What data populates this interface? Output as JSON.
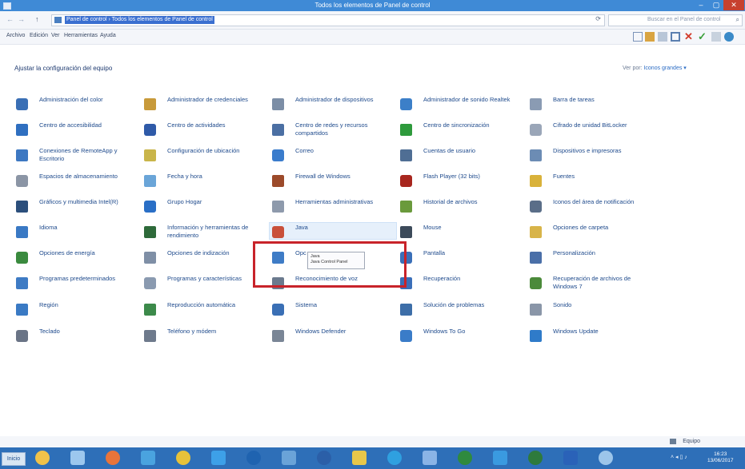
{
  "window": {
    "title": "Todos los elementos de Panel de control",
    "minimize": "–",
    "maximize": "▢",
    "close": "✕"
  },
  "address": {
    "back": "←",
    "forward": "→",
    "up": "↑",
    "path": "Panel de control › Todos los elementos de Panel de control",
    "refresh": "⟳",
    "search_placeholder": "Buscar en el Panel de control"
  },
  "menu": [
    "Archivo",
    "Edición",
    "Ver",
    "Herramientas",
    "Ayuda"
  ],
  "header": {
    "title": "Ajustar la configuración del equipo",
    "view_by_label": "Ver por:",
    "view_by_value": "Iconos grandes ▾"
  },
  "items": [
    {
      "label": "Administración del color",
      "icon": "color-management-icon",
      "color": "#3a6fb5"
    },
    {
      "label": "Administrador de credenciales",
      "icon": "credential-manager-icon",
      "color": "#c89a3a"
    },
    {
      "label": "Administrador de dispositivos",
      "icon": "device-manager-icon",
      "color": "#7c8ea6"
    },
    {
      "label": "Administrador de sonido Realtek",
      "icon": "realtek-audio-icon",
      "color": "#3c7fc8"
    },
    {
      "label": "Barra de tareas",
      "icon": "taskbar-icon",
      "color": "#8a9bb3"
    },
    {
      "label": "Centro de accesibilidad",
      "icon": "accessibility-icon",
      "color": "#2f6fc0"
    },
    {
      "label": "Centro de actividades",
      "icon": "action-center-icon",
      "color": "#2f5aa8"
    },
    {
      "label": "Centro de redes y recursos compartidos",
      "icon": "network-center-icon",
      "color": "#4b6fa3"
    },
    {
      "label": "Centro de sincronización",
      "icon": "sync-center-icon",
      "color": "#2e9a3c"
    },
    {
      "label": "Cifrado de unidad BitLocker",
      "icon": "bitlocker-icon",
      "color": "#9aa6b8"
    },
    {
      "label": "Conexiones de RemoteApp y Escritorio",
      "icon": "remoteapp-icon",
      "color": "#3d78c2"
    },
    {
      "label": "Configuración de ubicación",
      "icon": "location-settings-icon",
      "color": "#c9b54a"
    },
    {
      "label": "Correo",
      "icon": "mail-icon",
      "color": "#3a7ccc"
    },
    {
      "label": "Cuentas de usuario",
      "icon": "user-accounts-icon",
      "color": "#4f6e94"
    },
    {
      "label": "Dispositivos e impresoras",
      "icon": "printers-icon",
      "color": "#6c8cb4"
    },
    {
      "label": "Espacios de almacenamiento",
      "icon": "storage-spaces-icon",
      "color": "#8b95a5"
    },
    {
      "label": "Fecha y hora",
      "icon": "clock-icon",
      "color": "#6aa5d8"
    },
    {
      "label": "Firewall de Windows",
      "icon": "firewall-icon",
      "color": "#9c4a2a"
    },
    {
      "label": "Flash Player (32 bits)",
      "icon": "flash-icon",
      "color": "#a8261e"
    },
    {
      "label": "Fuentes",
      "icon": "fonts-icon",
      "color": "#d9b23a"
    },
    {
      "label": "Gráficos y multimedia Intel(R)",
      "icon": "intel-graphics-icon",
      "color": "#2c4f7c"
    },
    {
      "label": "Grupo Hogar",
      "icon": "homegroup-icon",
      "color": "#2a6fc6"
    },
    {
      "label": "Herramientas administrativas",
      "icon": "admin-tools-icon",
      "color": "#8e9aac"
    },
    {
      "label": "Historial de archivos",
      "icon": "file-history-icon",
      "color": "#6a9a3c"
    },
    {
      "label": "Iconos del área de notificación",
      "icon": "notification-icons-icon",
      "color": "#5a6e88"
    },
    {
      "label": "Idioma",
      "icon": "language-icon",
      "color": "#3a79c4"
    },
    {
      "label": "Información y herramientas de rendimiento",
      "icon": "performance-icon",
      "color": "#2e6a3a"
    },
    {
      "label": "Java",
      "icon": "java-icon",
      "color": "#c9503a"
    },
    {
      "label": "Mouse",
      "icon": "mouse-icon",
      "color": "#3c4a5a"
    },
    {
      "label": "Opciones de carpeta",
      "icon": "folder-options-icon",
      "color": "#d8b449"
    },
    {
      "label": "Opciones de energía",
      "icon": "power-options-icon",
      "color": "#3a8a3e"
    },
    {
      "label": "Opciones de indización",
      "icon": "indexing-icon",
      "color": "#7f8fa6"
    },
    {
      "label": "Opc",
      "icon": "internet-options-icon",
      "color": "#3e7cc6"
    },
    {
      "label": "Pantalla",
      "icon": "display-icon",
      "color": "#3a6fb8"
    },
    {
      "label": "Personalización",
      "icon": "personalization-icon",
      "color": "#4a6fa8"
    },
    {
      "label": "Programas predeterminados",
      "icon": "default-programs-icon",
      "color": "#3e7bc4"
    },
    {
      "label": "Programas y características",
      "icon": "programs-features-icon",
      "color": "#8a9ab0"
    },
    {
      "label": "Reconocimiento de voz",
      "icon": "speech-recognition-icon",
      "color": "#6b7a8e"
    },
    {
      "label": "Recuperación",
      "icon": "recovery-icon",
      "color": "#3b6fb9"
    },
    {
      "label": "Recuperación de archivos de Windows 7",
      "icon": "windows7-recovery-icon",
      "color": "#4b8a3a"
    },
    {
      "label": "Región",
      "icon": "region-icon",
      "color": "#3a7ac4"
    },
    {
      "label": "Reproducción automática",
      "icon": "autoplay-icon",
      "color": "#3c8a4a"
    },
    {
      "label": "Sistema",
      "icon": "system-icon",
      "color": "#3a6fb5"
    },
    {
      "label": "Solución de problemas",
      "icon": "troubleshooting-icon",
      "color": "#3d6ea8"
    },
    {
      "label": "Sonido",
      "icon": "sound-icon",
      "color": "#8a96a8"
    },
    {
      "label": "Teclado",
      "icon": "keyboard-icon",
      "color": "#6a7486"
    },
    {
      "label": "Teléfono y módem",
      "icon": "phone-modem-icon",
      "color": "#6e7a8c"
    },
    {
      "label": "Windows Defender",
      "icon": "defender-icon",
      "color": "#7a8696"
    },
    {
      "label": "Windows To Go",
      "icon": "windows-to-go-icon",
      "color": "#3a7cc8"
    },
    {
      "label": "Windows Update",
      "icon": "windows-update-icon",
      "color": "#2f7bc9"
    }
  ],
  "tooltip": {
    "title": "Java",
    "body": "Java Control Panel"
  },
  "status": {
    "text": "Equipo"
  },
  "taskbar": {
    "start": "Inicio",
    "clock_time": "16:23",
    "clock_date": "13/06/2017",
    "apps": [
      {
        "icon": "file-explorer-icon",
        "color": "#f0c24a"
      },
      {
        "icon": "command-prompt-icon",
        "color": "#9cc7ee"
      },
      {
        "icon": "firefox-icon",
        "color": "#e8743a"
      },
      {
        "icon": "search-icon",
        "color": "#4aa3df"
      },
      {
        "icon": "chrome-icon",
        "color": "#e6c23a"
      },
      {
        "icon": "internet-explorer-icon",
        "color": "#3da0e8"
      },
      {
        "icon": "outlook-icon",
        "color": "#1f63b0"
      },
      {
        "icon": "windows-store-icon",
        "color": "#6aa3d8"
      },
      {
        "icon": "media-center-icon",
        "color": "#2b5fa8"
      },
      {
        "icon": "paint-icon",
        "color": "#e8c74a"
      },
      {
        "icon": "skype-icon",
        "color": "#2fa0e0"
      },
      {
        "icon": "shield-icon",
        "color": "#8ab4e6"
      },
      {
        "icon": "excel-icon",
        "color": "#2f8a3e"
      },
      {
        "icon": "photos-icon",
        "color": "#3a9ae0"
      },
      {
        "icon": "project-icon",
        "color": "#2e7a3c"
      },
      {
        "icon": "word-icon",
        "color": "#2a62b8"
      },
      {
        "icon": "control-panel-icon",
        "color": "#9cc5ea"
      }
    ]
  }
}
